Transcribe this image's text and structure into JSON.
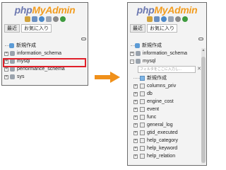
{
  "logo": {
    "php": "php",
    "my": "My",
    "admin": "Admin"
  },
  "tabs": {
    "recent": "最近",
    "favorites": "お気に入り"
  },
  "left_tree": {
    "items": [
      {
        "label": "新規作成",
        "type": "new"
      },
      {
        "label": "information_schema",
        "type": "db"
      },
      {
        "label": "mysql",
        "type": "db"
      },
      {
        "label": "performance_schema",
        "type": "db"
      },
      {
        "label": "sys",
        "type": "db"
      }
    ]
  },
  "right_tree": {
    "items": [
      {
        "label": "新規作成",
        "type": "new"
      },
      {
        "label": "information_schema",
        "type": "db"
      },
      {
        "label": "mysql",
        "type": "db-expanded"
      }
    ],
    "filter_placeholder": "フィルタをここに入力し...",
    "filter_clear": "✕",
    "tables": [
      {
        "label": "新規作成",
        "type": "new"
      },
      {
        "label": "columns_priv"
      },
      {
        "label": "db"
      },
      {
        "label": "engine_cost"
      },
      {
        "label": "event"
      },
      {
        "label": "func"
      },
      {
        "label": "general_log"
      },
      {
        "label": "gtid_executed"
      },
      {
        "label": "help_category"
      },
      {
        "label": "help_keyword"
      },
      {
        "label": "help_relation"
      }
    ]
  },
  "colors": {
    "highlight": "#e0202a",
    "arrow": "#f0901a",
    "logo_php": "#6c78b0",
    "logo_myadmin": "#f29c1f"
  }
}
